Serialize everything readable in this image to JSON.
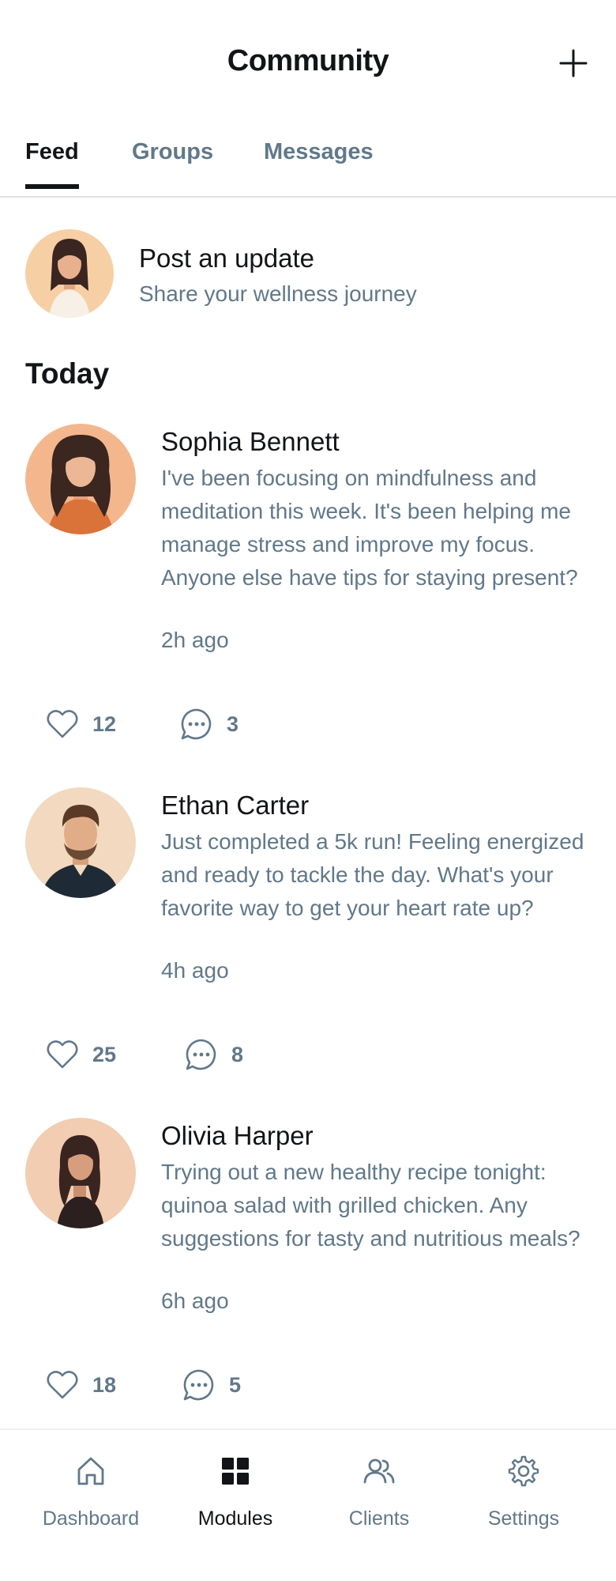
{
  "header": {
    "title": "Community"
  },
  "tabs": [
    {
      "label": "Feed",
      "active": true
    },
    {
      "label": "Groups",
      "active": false
    },
    {
      "label": "Messages",
      "active": false
    }
  ],
  "composer": {
    "title": "Post an update",
    "subtitle": "Share your wellness journey"
  },
  "section": {
    "title": "Today"
  },
  "posts": [
    {
      "author": "Sophia Bennett",
      "body": "I've been focusing on mindfulness and meditation this week. It's been helping me manage stress and improve my focus. Anyone else have tips for staying present?",
      "time": "2h ago",
      "likes": "12",
      "comments": "3"
    },
    {
      "author": "Ethan Carter",
      "body": "Just completed a 5k run! Feeling energized and ready to tackle the day. What's your favorite way to get your heart rate up?",
      "time": "4h ago",
      "likes": "25",
      "comments": "8"
    },
    {
      "author": "Olivia Harper",
      "body": "Trying out a new healthy recipe tonight: quinoa salad with grilled chicken. Any suggestions for tasty and nutritious meals?",
      "time": "6h ago",
      "likes": "18",
      "comments": "5"
    }
  ],
  "bottom_nav": [
    {
      "label": "Dashboard",
      "icon": "home-icon",
      "active": false
    },
    {
      "label": "Modules",
      "icon": "grid-icon",
      "active": true
    },
    {
      "label": "Clients",
      "icon": "users-icon",
      "active": false
    },
    {
      "label": "Settings",
      "icon": "gear-icon",
      "active": false
    }
  ],
  "colors": {
    "text_primary": "#121417",
    "text_secondary": "#61788a",
    "divider": "#dde1e5",
    "avatar_bg": "#f5cfa6"
  }
}
